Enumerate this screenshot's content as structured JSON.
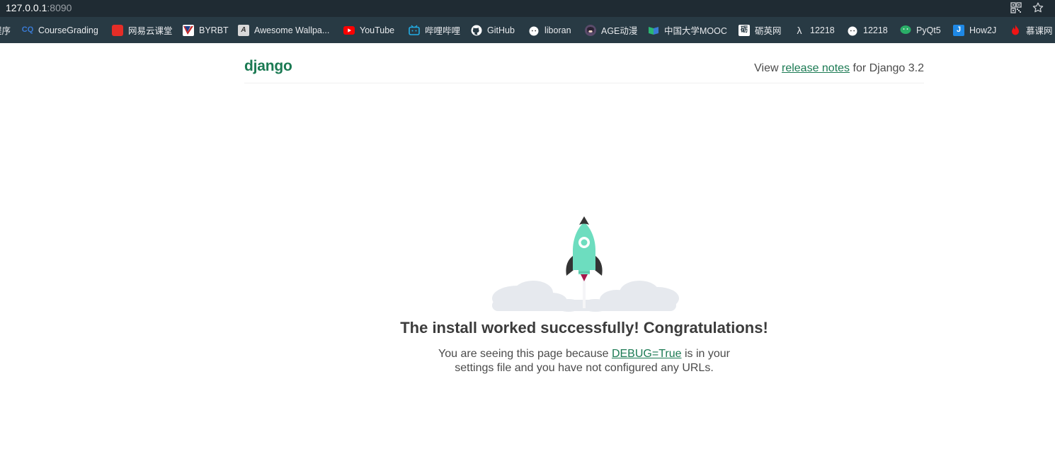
{
  "browser": {
    "url_host": "127.0.0.1",
    "url_port": ":8090",
    "bookmarks": [
      {
        "label": "程序",
        "icon": "cut-off-icon",
        "color": "#283a44"
      },
      {
        "label": "CourseGrading",
        "icon": "coursegrading-icon",
        "color": "#3a7bd5"
      },
      {
        "label": "网易云课堂",
        "icon": "netease-cloud-classroom-icon",
        "color": "#e52d27"
      },
      {
        "label": "BYRBT",
        "icon": "byrbt-icon",
        "color": "#1f3f8a"
      },
      {
        "label": "Awesome Wallpa...",
        "icon": "awesome-wallpaper-icon",
        "color": "#9a9a9a"
      },
      {
        "label": "YouTube",
        "icon": "youtube-icon",
        "color": "#ff0000"
      },
      {
        "label": "哔哩哔哩",
        "icon": "bilibili-icon",
        "color": "#23ade5"
      },
      {
        "label": "GitHub",
        "icon": "github-icon",
        "color": "#ffffff"
      },
      {
        "label": "liboran",
        "icon": "liboran-icon",
        "color": "#ffffff"
      },
      {
        "label": "AGE动漫",
        "icon": "age-anime-icon",
        "color": "#7a5c8a"
      },
      {
        "label": "中国大学MOOC",
        "icon": "mooc-icon",
        "color": "#2bb673"
      },
      {
        "label": "砺英网",
        "icon": "liying-icon",
        "color": "#ffffff"
      },
      {
        "label": "12218",
        "icon": "lambda-icon",
        "color": "#ffffff"
      },
      {
        "label": "12218",
        "icon": "liboran-icon",
        "color": "#ffffff"
      },
      {
        "label": "PyQt5",
        "icon": "wechat-icon",
        "color": "#2aae67"
      },
      {
        "label": "How2J",
        "icon": "how2j-icon",
        "color": "#1e88e5"
      },
      {
        "label": "慕课网",
        "icon": "flame-icon",
        "color": "#f01414"
      }
    ]
  },
  "header": {
    "logo": "django",
    "release_prefix": "View ",
    "release_link": "release notes",
    "release_suffix": " for Django 3.2"
  },
  "main": {
    "headline": "The install worked successfully! Congratulations!",
    "sub_prefix": "You are seeing this page because ",
    "debug_link": "DEBUG=True",
    "sub_mid": " is in your",
    "sub_line2": "settings file and you have not configured any URLs."
  },
  "colors": {
    "django_green": "#1b7a53",
    "rocket_body": "#6dddbf",
    "rocket_dark": "#333333",
    "cloud": "#e6e9ee"
  }
}
